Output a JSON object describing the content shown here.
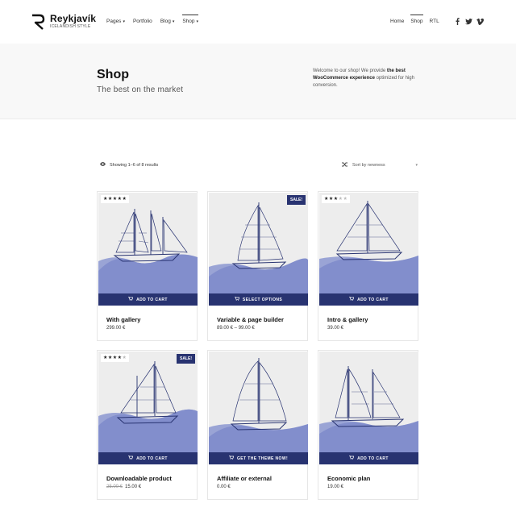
{
  "brand": {
    "name": "Reykjavík",
    "tagline": "ICELANDISH STYLE"
  },
  "nav": {
    "items": [
      {
        "label": "Pages",
        "caret": "▾"
      },
      {
        "label": "Portfolio",
        "caret": ""
      },
      {
        "label": "Blog",
        "caret": "▾"
      },
      {
        "label": "Shop",
        "caret": "▾"
      }
    ],
    "right": [
      {
        "label": "Home"
      },
      {
        "label": "Shop"
      },
      {
        "label": "RTL"
      }
    ],
    "socials": [
      "facebook-icon",
      "twitter-icon",
      "vimeo-icon"
    ]
  },
  "hero": {
    "title": "Shop",
    "subtitle": "The best on the market",
    "desc_pre": "Welcome to our shop! We provide ",
    "desc_bold": "the best WooCommerce experience",
    "desc_post": " optimized for high conversion."
  },
  "toolbar": {
    "result_count": "Showing 1–6 of 8 results",
    "sort_selected": "Sort by newness"
  },
  "products": [
    {
      "title": "With gallery",
      "price": "299.00 €",
      "old_price": "",
      "button": "ADD TO CART",
      "stars": "★★★★★",
      "stars_off": "",
      "sale": ""
    },
    {
      "title": "Variable & page builder",
      "price": "89.00 € – 99.00 €",
      "old_price": "",
      "button": "SELECT OPTIONS",
      "stars": "",
      "stars_off": "",
      "sale": "SALE!"
    },
    {
      "title": "Intro & gallery",
      "price": "39.00 €",
      "old_price": "",
      "button": "ADD TO CART",
      "stars": "★★★",
      "stars_off": "★★",
      "sale": ""
    },
    {
      "title": "Downloadable product",
      "price": "15.00 €",
      "old_price": "25.00 €",
      "button": "ADD TO CART",
      "stars": "★★★★",
      "stars_off": "★",
      "sale": "SALE!"
    },
    {
      "title": "Affiliate or external",
      "price": "0.00 €",
      "old_price": "",
      "button": "GET THE THEME NOW!",
      "stars": "",
      "stars_off": "",
      "sale": ""
    },
    {
      "title": "Economic plan",
      "price": "19.00 €",
      "old_price": "",
      "button": "ADD TO CART",
      "stars": "",
      "stars_off": "",
      "sale": ""
    }
  ],
  "colors": {
    "accent": "#283371",
    "wave": "#8b97d0",
    "ink": "#283371"
  }
}
